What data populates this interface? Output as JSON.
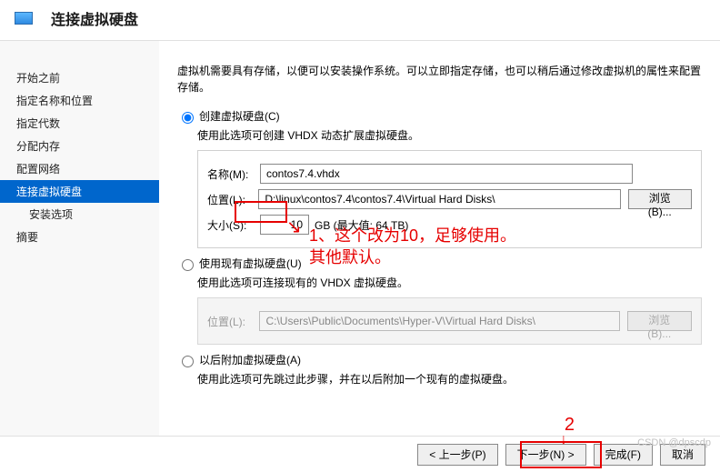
{
  "header": {
    "title": "连接虚拟硬盘"
  },
  "sidebar": {
    "items": [
      {
        "label": "开始之前"
      },
      {
        "label": "指定名称和位置"
      },
      {
        "label": "指定代数"
      },
      {
        "label": "分配内存"
      },
      {
        "label": "配置网络"
      },
      {
        "label": "连接虚拟硬盘"
      },
      {
        "label": "安装选项"
      },
      {
        "label": "摘要"
      }
    ]
  },
  "intro": "虚拟机需要具有存储，以便可以安装操作系统。可以立即指定存储，也可以稍后通过修改虚拟机的属性来配置存储。",
  "opt1": {
    "label": "创建虚拟硬盘(C)",
    "hint": "使用此选项可创建 VHDX 动态扩展虚拟硬盘。",
    "name_label": "名称(M):",
    "name_value": "contos7.4.vhdx",
    "loc_label": "位置(L):",
    "loc_value": "D:\\linux\\contos7.4\\contos7.4\\Virtual Hard Disks\\",
    "browse": "浏览(B)...",
    "size_label": "大小(S):",
    "size_value": "10",
    "size_suffix": "GB (最大值: 64 TB)"
  },
  "opt2": {
    "label": "使用现有虚拟硬盘(U)",
    "hint": "使用此选项可连接现有的 VHDX 虚拟硬盘。",
    "loc_label": "位置(L):",
    "loc_value": "C:\\Users\\Public\\Documents\\Hyper-V\\Virtual Hard Disks\\",
    "browse": "浏览(B)..."
  },
  "opt3": {
    "label": "以后附加虚拟硬盘(A)",
    "hint": "使用此选项可先跳过此步骤，并在以后附加一个现有的虚拟硬盘。"
  },
  "footer": {
    "prev": "< 上一步(P)",
    "next": "下一步(N) >",
    "finish": "完成(F)",
    "cancel": "取消"
  },
  "anno": {
    "line1": "1、这个改为10，足够使用。",
    "line2": "其他默认。",
    "two": "2"
  },
  "watermark": "CSDN @dpscdp"
}
